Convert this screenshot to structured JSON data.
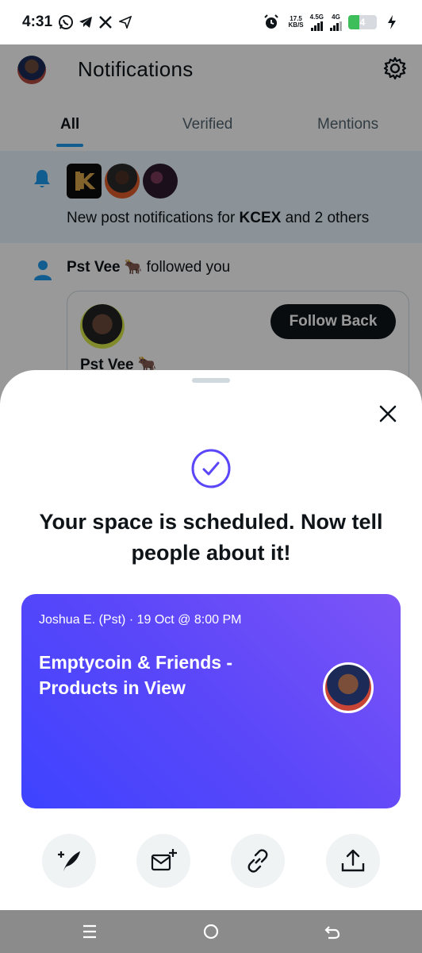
{
  "status_bar": {
    "time": "4:31",
    "net_speed_value": "17.5",
    "net_speed_unit": "KB/S",
    "signal_1_label": "4.5G",
    "signal_2_label": "4G",
    "battery_level": "4",
    "icons": [
      "whatsapp-icon",
      "telegram-icon",
      "x-logo-icon",
      "send-icon",
      "alarm-icon",
      "charging-icon"
    ]
  },
  "header": {
    "title": "Notifications",
    "settings_icon": "gear-icon"
  },
  "tabs": [
    {
      "label": "All",
      "active": true
    },
    {
      "label": "Verified",
      "active": false
    },
    {
      "label": "Mentions",
      "active": false
    }
  ],
  "notifications": [
    {
      "type": "post_notifications",
      "text_prefix": "New post notifications for ",
      "highlight": "KCEX",
      "text_suffix": " and 2 others"
    },
    {
      "type": "follow",
      "name": "Pst Vee",
      "emoji": "🐂",
      "action": "followed you",
      "card_name": "Pst Vee",
      "follow_back_label": "Follow Back"
    }
  ],
  "sheet": {
    "title": "Your space is scheduled. Now tell people about it!",
    "space_card": {
      "meta": "Joshua E. (Pst) · 19 Oct @ 8:00 PM",
      "title": "Emptycoin & Friends - Products in View"
    },
    "actions": [
      "compose-quill-icon",
      "add-dm-icon",
      "link-icon",
      "share-upload-icon"
    ]
  },
  "nav_bar": {
    "buttons": [
      "menu-icon",
      "home-circle-icon",
      "back-arrow-icon"
    ]
  },
  "colors": {
    "accent": "#1d9bf0",
    "card_gradient_start": "#3e43ff",
    "card_gradient_end": "#7d54f7",
    "check_purple": "#5b47f9"
  }
}
